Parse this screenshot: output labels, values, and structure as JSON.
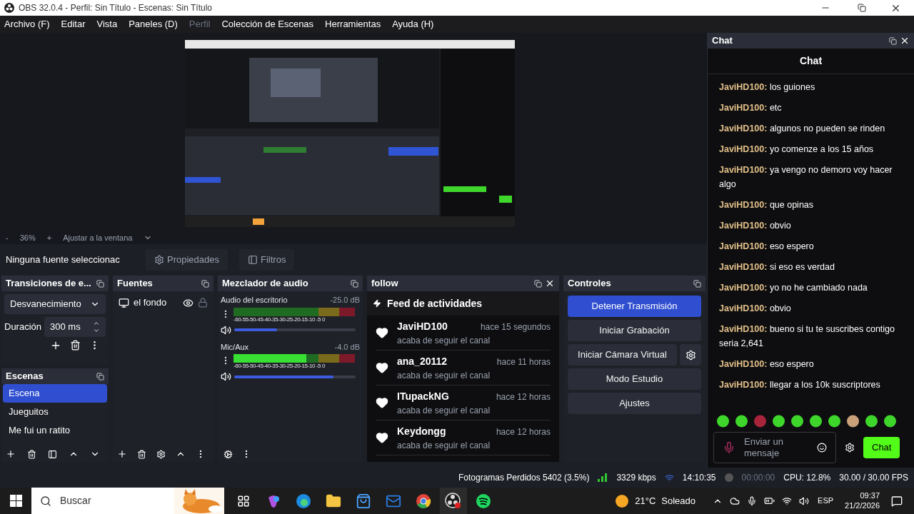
{
  "window": {
    "title": "OBS 32.0.4 - Perfil: Sin Título - Escenas: Sin Título"
  },
  "menu": [
    {
      "label": "Archivo (F)",
      "disabled": false
    },
    {
      "label": "Editar",
      "disabled": false
    },
    {
      "label": "Vista",
      "disabled": false
    },
    {
      "label": "Paneles (D)",
      "disabled": false
    },
    {
      "label": "Perfil",
      "disabled": true
    },
    {
      "label": "Colección de Escenas",
      "disabled": false
    },
    {
      "label": "Herramientas",
      "disabled": false
    },
    {
      "label": "Ayuda (H)",
      "disabled": false
    }
  ],
  "preview_bar": {
    "zoom_out": "-",
    "zoom": "36%",
    "zoom_in": "+",
    "fit": "Ajustar a la ventana"
  },
  "source_toolbar": {
    "status": "Ninguna fuente seleccionac",
    "properties": "Propiedades",
    "filters": "Filtros"
  },
  "transitions": {
    "title": "Transiciones de e...",
    "transition": "Desvanecimiento",
    "duration_label": "Duración",
    "duration": "300 ms"
  },
  "scenes": {
    "title": "Escenas",
    "items": [
      {
        "name": "Escena",
        "selected": true
      },
      {
        "name": "Jueguitos",
        "selected": false
      },
      {
        "name": "Me fui un ratito",
        "selected": false
      }
    ]
  },
  "sources": {
    "title": "Fuentes",
    "items": [
      {
        "name": "el fondo",
        "visible": true
      }
    ]
  },
  "mixer": {
    "title": "Mezclador de audio",
    "channels": [
      {
        "name": "Audio del escritorio",
        "reading": "-25.0 dB",
        "volume": {
          "level": 0.35
        },
        "scale": "-60-55-50-45-40-35-30-25-20-15-10 -5 0"
      },
      {
        "name": "Mic/Aux",
        "reading": "-4.0 dB",
        "meter": {
          "level": 0.6
        },
        "volume": {
          "level": 0.82
        },
        "scale": "-60-55-50-45-40-35-30-25-20-15-10 -5 0"
      }
    ]
  },
  "follow": {
    "title": "follow",
    "feed_title": "Feed de actividades",
    "events": [
      {
        "user": "JaviHD100",
        "time": "hace 15 segundos",
        "action": "acaba de seguir el canal"
      },
      {
        "user": "ana_20112",
        "time": "hace 11 horas",
        "action": "acaba de seguir el canal"
      },
      {
        "user": "ITupackNG",
        "time": "hace 12 horas",
        "action": "acaba de seguir el canal"
      },
      {
        "user": "Keydongg",
        "time": "hace 12 horas",
        "action": "acaba de seguir el canal"
      }
    ]
  },
  "controls": {
    "title": "Controles",
    "buttons": [
      {
        "label": "Detener Transmisión",
        "active": true,
        "kind": "plain"
      },
      {
        "label": "Iniciar Grabación",
        "active": false,
        "kind": "plain"
      },
      {
        "label": "Iniciar Cámara Virtual",
        "active": false,
        "kind": "with_settings"
      },
      {
        "label": "Modo Estudio",
        "active": false,
        "kind": "plain"
      },
      {
        "label": "Ajustes",
        "active": false,
        "kind": "plain"
      }
    ]
  },
  "chat": {
    "dock_title": "Chat",
    "header": "Chat",
    "messages": [
      {
        "user": "JaviHD100:",
        "text": "los guiones"
      },
      {
        "user": "JaviHD100:",
        "text": "etc"
      },
      {
        "user": "JaviHD100:",
        "text": "algunos no pueden se rinden"
      },
      {
        "user": "JaviHD100:",
        "text": "yo comenze a los 15 años"
      },
      {
        "user": "JaviHD100:",
        "text": "ya vengo no demoro voy hacer algo"
      },
      {
        "user": "JaviHD100:",
        "text": "que opinas"
      },
      {
        "user": "JaviHD100:",
        "text": "obvio"
      },
      {
        "user": "JaviHD100:",
        "text": "eso espero"
      },
      {
        "user": "JaviHD100:",
        "text": "si eso es verdad"
      },
      {
        "user": "JaviHD100:",
        "text": "yo no he cambiado nada"
      },
      {
        "user": "JaviHD100:",
        "text": "obvio"
      },
      {
        "user": "JaviHD100:",
        "text": "bueno si tu te suscribes contigo seria 2,641"
      },
      {
        "user": "JaviHD100:",
        "text": "eso espero"
      },
      {
        "user": "JaviHD100:",
        "text": "llegar a los 10k suscriptores"
      }
    ],
    "emotes": [
      {
        "color": "#3fd62c"
      },
      {
        "color": "#3fd62c"
      },
      {
        "color": "#a8243a"
      },
      {
        "color": "#3fd62c"
      },
      {
        "color": "#3fd62c"
      },
      {
        "color": "#3fd62c"
      },
      {
        "color": "#3fd62c"
      },
      {
        "color": "#c9a27a"
      },
      {
        "color": "#3fd62c"
      },
      {
        "color": "#3fd62c"
      }
    ],
    "input": {
      "placeholder": "Enviar un mensaje"
    },
    "send": "Chat"
  },
  "status_bar": {
    "dropped": "Fotogramas Perdidos 5402 (3.5%)",
    "bitrate": "3329 kbps",
    "stream_time": "14:10:35",
    "record_time": "00:00:00",
    "cpu": "CPU: 12.8%",
    "fps": "30.00 / 30.00 FPS"
  },
  "taskbar": {
    "search": {
      "placeholder": "Buscar"
    },
    "apps": [
      {
        "kind": "taskview"
      },
      {
        "kind": "copilot"
      },
      {
        "kind": "edge"
      },
      {
        "kind": "explorer"
      },
      {
        "kind": "store"
      },
      {
        "kind": "outlook"
      },
      {
        "kind": "chrome"
      },
      {
        "kind": "obs"
      },
      {
        "kind": "spotify"
      }
    ],
    "weather_temp": "21°C",
    "weather_text": "Soleado",
    "language": "ESP",
    "time": "09:37",
    "date": "21/2/2026"
  }
}
